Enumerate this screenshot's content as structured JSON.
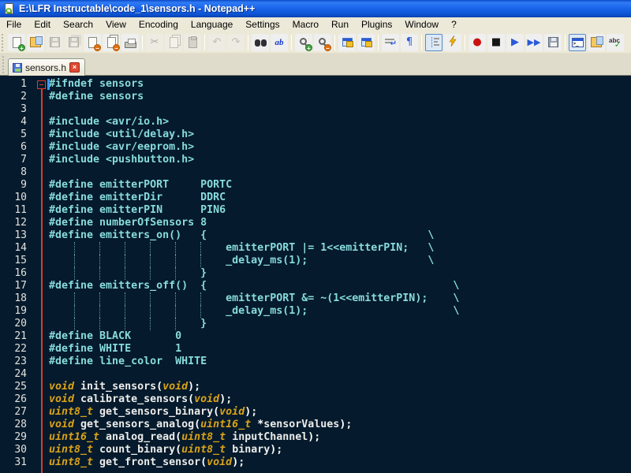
{
  "window": {
    "title": "E:\\LFR Instructable\\code_1\\sensors.h - Notepad++"
  },
  "menu_items": [
    "File",
    "Edit",
    "Search",
    "View",
    "Encoding",
    "Language",
    "Settings",
    "Macro",
    "Run",
    "Plugins",
    "Window",
    "?"
  ],
  "toolbar_groups": [
    [
      {
        "name": "new-file",
        "kind": "page",
        "badge": "plus"
      },
      {
        "name": "open-file",
        "kind": "folder"
      },
      {
        "name": "save",
        "kind": "floppy",
        "disabled": true
      },
      {
        "name": "save-all",
        "kind": "floppy-all",
        "disabled": true
      },
      {
        "name": "close",
        "kind": "page",
        "badge": "minus"
      },
      {
        "name": "close-all",
        "kind": "pages",
        "badge": "minus"
      },
      {
        "name": "print",
        "kind": "printer"
      }
    ],
    [
      {
        "name": "cut",
        "kind": "glyph",
        "glyph": "✂",
        "color": "#606060",
        "disabled": true
      },
      {
        "name": "copy",
        "kind": "pages",
        "disabled": true
      },
      {
        "name": "paste",
        "kind": "clipboard",
        "disabled": true
      }
    ],
    [
      {
        "name": "undo",
        "kind": "glyph",
        "glyph": "↶",
        "color": "#8A8A80",
        "disabled": true
      },
      {
        "name": "redo",
        "kind": "glyph",
        "glyph": "↷",
        "color": "#8A8A80",
        "disabled": true
      }
    ],
    [
      {
        "name": "find",
        "kind": "binoculars"
      },
      {
        "name": "replace",
        "kind": "replace",
        "text": "ab"
      }
    ],
    [
      {
        "name": "zoom-in",
        "kind": "magnifier",
        "badge": "plus"
      },
      {
        "name": "zoom-out",
        "kind": "magnifier",
        "badge": "minus"
      }
    ],
    [
      {
        "name": "sync-vertical-scrolling",
        "kind": "sync"
      },
      {
        "name": "sync-horizontal-scrolling",
        "kind": "sync"
      }
    ],
    [
      {
        "name": "word-wrap",
        "kind": "wrap"
      },
      {
        "name": "show-all-characters",
        "kind": "glyph",
        "glyph": "¶",
        "color": "#2A5AD8"
      }
    ],
    [
      {
        "name": "show-indent-guide",
        "kind": "indent",
        "pressed": true
      },
      {
        "name": "user-define-dialog",
        "kind": "bolt"
      }
    ],
    [
      {
        "name": "macro-record",
        "kind": "glyph",
        "glyph": "●",
        "color": "#CC1111"
      },
      {
        "name": "macro-stop",
        "kind": "glyph",
        "glyph": "■",
        "color": "#151515"
      },
      {
        "name": "macro-play",
        "kind": "glyph",
        "glyph": "▶",
        "color": "#2A5AD8"
      },
      {
        "name": "macro-run-multiple",
        "kind": "glyph",
        "glyph": "▶▶",
        "color": "#2A5AD8",
        "small": true
      },
      {
        "name": "macro-save",
        "kind": "floppy-win"
      }
    ],
    [
      {
        "name": "console",
        "kind": "console",
        "pressed": true
      },
      {
        "name": "explorer",
        "kind": "folder"
      },
      {
        "name": "spell-check",
        "kind": "spell",
        "text": "abc",
        "check": "✓"
      }
    ]
  ],
  "tabs": [
    {
      "label": "sensors.h",
      "state": "saved",
      "active": true,
      "close_glyph": "×"
    }
  ],
  "editor": {
    "palette": {
      "background": "#051A2C",
      "preprocessor": "#87DBDB",
      "keyword": "#DAA218",
      "identifier": "#ECECEA",
      "operator": "#FFFFFF",
      "line_number": "#E2E2DE",
      "fold_line": "#E23A2C",
      "caret": "#3A9BFC",
      "indent_guide": "#66A0A0"
    },
    "lines": [
      {
        "n": 1,
        "fold": "open",
        "caret": true,
        "seg": [
          [
            "pre",
            "#ifndef sensors"
          ]
        ]
      },
      {
        "n": 2,
        "seg": [
          [
            "pre",
            "#define sensors"
          ]
        ]
      },
      {
        "n": 3,
        "seg": []
      },
      {
        "n": 4,
        "seg": [
          [
            "pre",
            "#include <avr/io.h>"
          ]
        ]
      },
      {
        "n": 5,
        "seg": [
          [
            "pre",
            "#include <util/delay.h>"
          ]
        ]
      },
      {
        "n": 6,
        "seg": [
          [
            "pre",
            "#include <avr/eeprom.h>"
          ]
        ]
      },
      {
        "n": 7,
        "seg": [
          [
            "pre",
            "#include <pushbutton.h>"
          ]
        ]
      },
      {
        "n": 8,
        "seg": []
      },
      {
        "n": 9,
        "seg": [
          [
            "pre",
            "#define emitterPORT     PORTC"
          ]
        ]
      },
      {
        "n": 10,
        "seg": [
          [
            "pre",
            "#define emitterDir      DDRC"
          ]
        ]
      },
      {
        "n": 11,
        "seg": [
          [
            "pre",
            "#define emitterPIN      PIN6"
          ]
        ]
      },
      {
        "n": 12,
        "seg": [
          [
            "pre",
            "#define numberOfSensors 8"
          ]
        ]
      },
      {
        "n": 13,
        "seg": [
          [
            "pre",
            "#define emitters_on()   {                                   \\"
          ]
        ]
      },
      {
        "n": 14,
        "seg": [
          [
            "pre",
            "                            emitterPORT |= 1<<emitterPIN;   \\"
          ]
        ]
      },
      {
        "n": 15,
        "seg": [
          [
            "pre",
            "                            _delay_ms(1);                   \\"
          ]
        ]
      },
      {
        "n": 16,
        "seg": [
          [
            "pre",
            "                        }"
          ]
        ]
      },
      {
        "n": 17,
        "seg": [
          [
            "pre",
            "#define emitters_off()  {                                       \\"
          ]
        ]
      },
      {
        "n": 18,
        "seg": [
          [
            "pre",
            "                            emitterPORT &= ~(1<<emitterPIN);    \\"
          ]
        ]
      },
      {
        "n": 19,
        "seg": [
          [
            "pre",
            "                            _delay_ms(1);                       \\"
          ]
        ]
      },
      {
        "n": 20,
        "seg": [
          [
            "pre",
            "                        }"
          ]
        ]
      },
      {
        "n": 21,
        "seg": [
          [
            "pre",
            "#define BLACK       0"
          ]
        ]
      },
      {
        "n": 22,
        "seg": [
          [
            "pre",
            "#define WHITE       1"
          ]
        ]
      },
      {
        "n": 23,
        "seg": [
          [
            "pre",
            "#define line_color  WHITE"
          ]
        ]
      },
      {
        "n": 24,
        "seg": []
      },
      {
        "n": 25,
        "seg": [
          [
            "kw",
            "void"
          ],
          [
            "id",
            " init_sensors"
          ],
          [
            "op",
            "("
          ],
          [
            "kw",
            "void"
          ],
          [
            "op",
            ")"
          ],
          [
            "id",
            ";"
          ]
        ]
      },
      {
        "n": 26,
        "seg": [
          [
            "kw",
            "void"
          ],
          [
            "id",
            " calibrate_sensors"
          ],
          [
            "op",
            "("
          ],
          [
            "kw",
            "void"
          ],
          [
            "op",
            ")"
          ],
          [
            "id",
            ";"
          ]
        ]
      },
      {
        "n": 27,
        "seg": [
          [
            "kw",
            "uint8_t"
          ],
          [
            "id",
            " get_sensors_binary"
          ],
          [
            "op",
            "("
          ],
          [
            "kw",
            "void"
          ],
          [
            "op",
            ")"
          ],
          [
            "id",
            ";"
          ]
        ]
      },
      {
        "n": 28,
        "seg": [
          [
            "kw",
            "void"
          ],
          [
            "id",
            " get_sensors_analog"
          ],
          [
            "op",
            "("
          ],
          [
            "kw",
            "uint16_t"
          ],
          [
            "id",
            " "
          ],
          [
            "op",
            "*"
          ],
          [
            "id",
            "sensorValues"
          ],
          [
            "op",
            ")"
          ],
          [
            "id",
            ";"
          ]
        ]
      },
      {
        "n": 29,
        "seg": [
          [
            "kw",
            "uint16_t"
          ],
          [
            "id",
            " analog_read"
          ],
          [
            "op",
            "("
          ],
          [
            "kw",
            "uint8_t"
          ],
          [
            "id",
            " inputChannel"
          ],
          [
            "op",
            ")"
          ],
          [
            "id",
            ";"
          ]
        ]
      },
      {
        "n": 30,
        "seg": [
          [
            "kw",
            "uint8_t"
          ],
          [
            "id",
            " count_binary"
          ],
          [
            "op",
            "("
          ],
          [
            "kw",
            "uint8_t"
          ],
          [
            "id",
            " binary"
          ],
          [
            "op",
            ")"
          ],
          [
            "id",
            ";"
          ]
        ]
      },
      {
        "n": 31,
        "seg": [
          [
            "kw",
            "uint8_t"
          ],
          [
            "id",
            " get_front_sensor"
          ],
          [
            "op",
            "("
          ],
          [
            "kw",
            "void"
          ],
          [
            "op",
            ")"
          ],
          [
            "id",
            ";"
          ]
        ]
      }
    ]
  }
}
